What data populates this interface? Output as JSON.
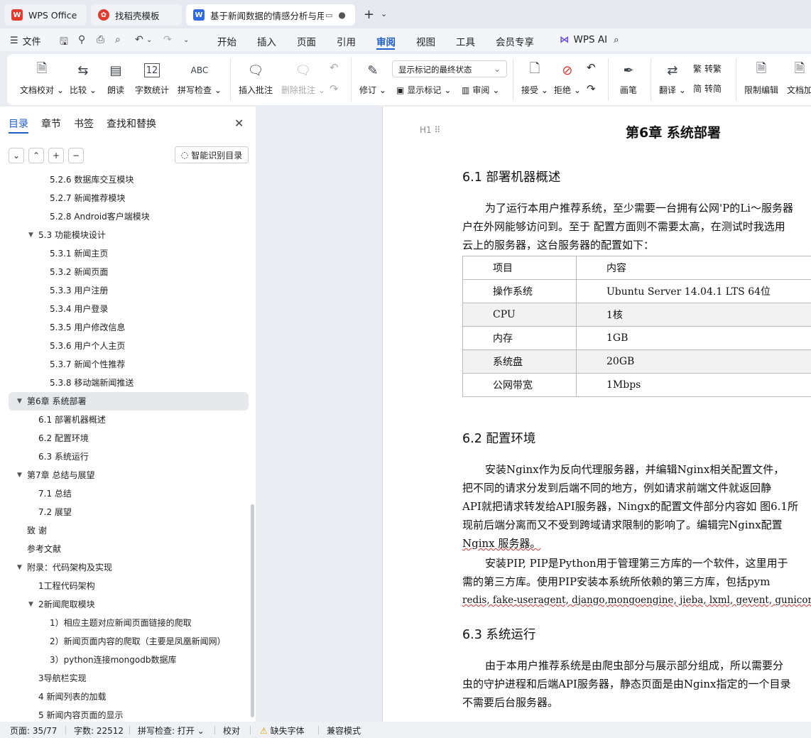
{
  "tabs": [
    {
      "title": "WPS Office",
      "icon": "wps-logo-icon",
      "color": "#e23b2e"
    },
    {
      "title": "找稻壳模板",
      "icon": "docer-icon",
      "color": "#e23b2e"
    },
    {
      "title": "基于新闻数据的情感分析与用户",
      "icon": "wps-writer-icon",
      "color": "#2f6be0"
    }
  ],
  "menubar": {
    "file": "文件",
    "items": [
      "开始",
      "插入",
      "页面",
      "引用",
      "审阅",
      "视图",
      "工具",
      "会员专享"
    ],
    "active": "审阅",
    "wps_ai": "WPS AI"
  },
  "ribbon": {
    "doc_proofread": "文档校对",
    "compare": "比较",
    "read_aloud": "朗读",
    "word_count": "字数统计",
    "spell_check": "拼写检查",
    "insert_comment": "插入批注",
    "delete_comment": "删除批注",
    "track_changes": "修订",
    "markup_select": "显示标记的最终状态",
    "show_markup": "显示标记",
    "review": "审阅",
    "accept": "接受",
    "reject": "拒绝",
    "ink": "画笔",
    "translate": "翻译",
    "to_traditional": "转繁",
    "to_simplified": "转简",
    "restrict_edit": "限制编辑",
    "doc_encrypt": "文档加"
  },
  "sidebar": {
    "tabs": [
      "目录",
      "章节",
      "书签",
      "查找和替换"
    ],
    "smart_toc": "智能识别目录",
    "toc": [
      {
        "text": "5.2.6 数据库交互模块",
        "level": 3
      },
      {
        "text": "5.2.7 新闻推荐模块",
        "level": 3
      },
      {
        "text": "5.2.8 Android客户端模块",
        "level": 3
      },
      {
        "text": "5.3 功能模块设计",
        "level": 2,
        "caret": true
      },
      {
        "text": "5.3.1 新闻主页",
        "level": 3
      },
      {
        "text": "5.3.2 新闻页面",
        "level": 3
      },
      {
        "text": "5.3.3 用户注册",
        "level": 3
      },
      {
        "text": "5.3.4 用户登录",
        "level": 3
      },
      {
        "text": "5.3.5 用户修改信息",
        "level": 3
      },
      {
        "text": "5.3.6 用户个人主页",
        "level": 3
      },
      {
        "text": "5.3.7 新闻个性推荐",
        "level": 3
      },
      {
        "text": "5.3.8 移动端新闻推送",
        "level": 3
      },
      {
        "text": "第6章  系统部署",
        "level": 1,
        "caret": true,
        "selected": true
      },
      {
        "text": "6.1 部署机器概述",
        "level": 2
      },
      {
        "text": "6.2 配置环境",
        "level": 2
      },
      {
        "text": "6.3 系统运行",
        "level": 2
      },
      {
        "text": "第7章  总结与展望",
        "level": 1,
        "caret": true
      },
      {
        "text": "7.1 总结",
        "level": 2
      },
      {
        "text": "7.2 展望",
        "level": 2
      },
      {
        "text": "致    谢",
        "level": 1
      },
      {
        "text": "参考文献",
        "level": 1
      },
      {
        "text": "附录：代码架构及实现",
        "level": 1,
        "caret": true
      },
      {
        "text": "1工程代码架构",
        "level": 2
      },
      {
        "text": "2新闻爬取模块",
        "level": 2,
        "caret": true
      },
      {
        "text": "1）相应主题对应新闻页面链接的爬取",
        "level": 3
      },
      {
        "text": "2）新闻页面内容的爬取（主要是凤凰新闻网）",
        "level": 3
      },
      {
        "text": "3）python连接mongodb数据库",
        "level": 3
      },
      {
        "text": "3导航栏实现",
        "level": 2
      },
      {
        "text": "4 新闻列表的加载",
        "level": 2
      },
      {
        "text": "5 新闻内容页面的显示",
        "level": 2
      }
    ]
  },
  "doc": {
    "heading_marker": "H1",
    "chapter_title": "第6章  系统部署",
    "s61_title": "6.1 部署机器概述",
    "s61_p": [
      "为了运行本用户推荐系统，至少需要一台拥有公网'P的Li～服务器",
      "户在外网能够访问到。至于 配置方面则不需要太高，在测试时我选用",
      "云上的服务器，这台服务器的配置如下："
    ],
    "table": [
      [
        "项目",
        "内容"
      ],
      [
        "操作系统",
        "Ubuntu Server 14.04.1 LTS  64位"
      ],
      [
        "CPU",
        "1核"
      ],
      [
        "内存",
        "1GB"
      ],
      [
        "系统盘",
        "20GB"
      ],
      [
        "公网带宽",
        "1Mbps"
      ]
    ],
    "s62_title": "6.2 配置环境",
    "s62_p": [
      "安装Nginx作为反向代理服务器，并编辑Nginx相关配置文件，",
      "把不同的请求分发到后端不同的地方，例如请求前端文件就返回静",
      "API就把请求转发给API服务器，Ningx的配置文件部分内容如   图6.1所",
      "现前后端分离而又不受到跨域请求限制的影响了。编辑完Nginx配置",
      "Nginx 服务器。",
      "安装PIP, PIP是Python用于管理第三方库的一个软件，这里用于",
      "需的第三方库。使用PIP安装本系统所依赖的第三方库，包括pym",
      "redis, fake-useragent, django,mongoengine, jieba, lxml, gevent, gunicorn"
    ],
    "s63_title": "6.3 系统运行",
    "s63_p": [
      "由于本用户推荐系统是由爬虫部分与展示部分组成，所以需要分",
      "虫的守护进程和后端API服务器，静态页面是由Nginx指定的一个目录",
      "不需要后台服务器。"
    ]
  },
  "status": {
    "page": "页面: 35/77",
    "words": "字数: 22512",
    "spell": "拼写检查: 打开",
    "proof": "校对",
    "missing_font": "缺失字体",
    "compat": "兼容模式"
  }
}
